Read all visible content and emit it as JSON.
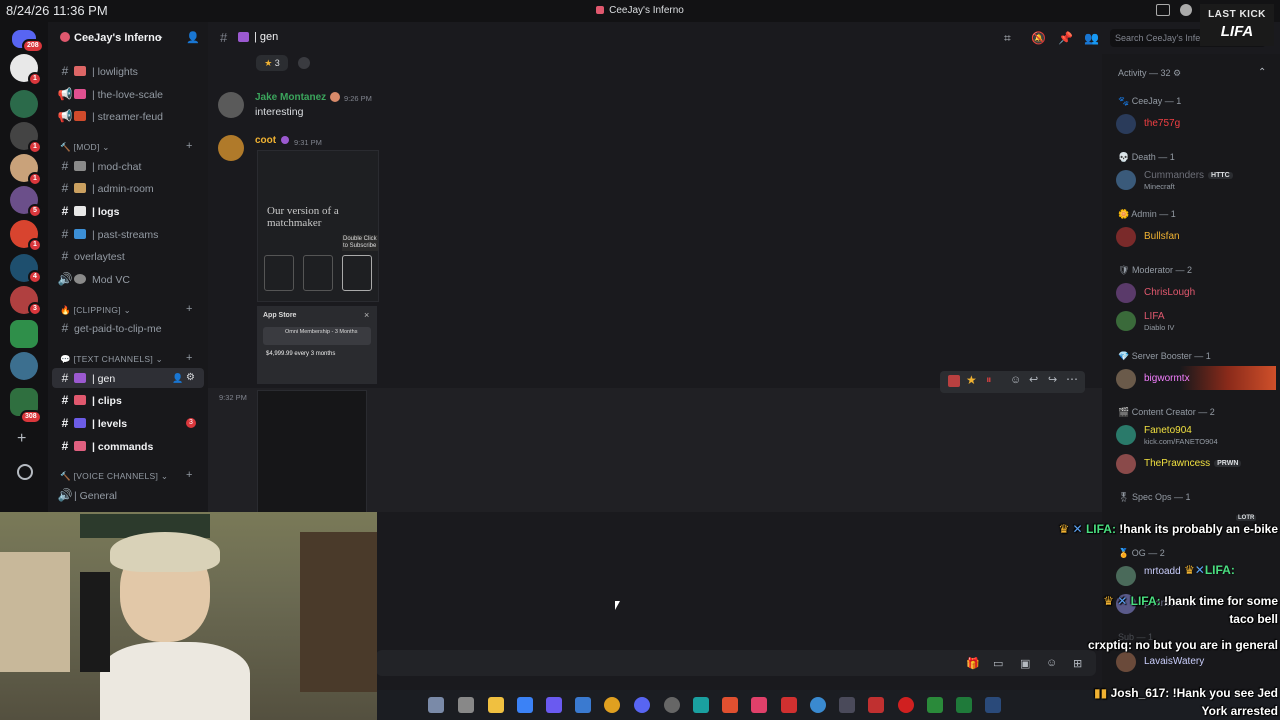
{
  "os": {
    "clock": "8/24/26 11:36 PM",
    "window_title": "CeeJay's Inferno"
  },
  "servers": {
    "badges": [
      "208",
      "1",
      "1",
      "1",
      "5",
      "1",
      "1",
      "4",
      "3",
      "3",
      "308"
    ]
  },
  "sidebar": {
    "server_name": "CeeJay's Inferno",
    "channels_top": [
      {
        "label": "| lowlights"
      },
      {
        "label": "| the-love-scale"
      },
      {
        "label": "| streamer-feud"
      }
    ],
    "cat_mod": "[MOD]",
    "mod_channels": [
      {
        "label": "| mod-chat"
      },
      {
        "label": "| admin-room"
      },
      {
        "label": "| logs"
      },
      {
        "label": "| past-streams"
      },
      {
        "label": "overlaytest"
      },
      {
        "label": "Mod VC"
      }
    ],
    "cat_clipping": "[CLIPPING]",
    "clip_channel": "get-paid-to-clip-me",
    "cat_text": "[TEXT CHANNELS]",
    "text_channels": [
      {
        "label": "gen"
      },
      {
        "label": "| clips"
      },
      {
        "label": "| levels",
        "badge": "3"
      },
      {
        "label": "| commands"
      }
    ],
    "cat_voice": "[VOICE CHANNELS]",
    "voice_channel": "| General"
  },
  "header": {
    "channel": "| gen",
    "search_placeholder": "Search CeeJay's Inferno"
  },
  "messages": {
    "reaction_count": "3",
    "m1": {
      "author": "Jake Montanez",
      "time": "9:26 PM",
      "text": "interesting"
    },
    "m2": {
      "author": "coot",
      "time": "9:31 PM"
    },
    "m3": {
      "time": "9:32 PM"
    },
    "shot1": {
      "title": "Our version of a matchmaker",
      "tooltip": "Double Click to Subscribe",
      "appstore": "App Store",
      "sub_title": "Omni Membership - 3 Months",
      "price": "$4,999.99 every 3 months"
    }
  },
  "members": {
    "activity": "Activity — 32",
    "groups": [
      {
        "title": "CeeJay — 1",
        "members": [
          {
            "name": "the757g"
          }
        ]
      },
      {
        "title": "Death — 1",
        "members": [
          {
            "name": "Cummanders",
            "tag": "HTTC",
            "sub": "Minecraft"
          }
        ]
      },
      {
        "title": "Admin — 1",
        "members": [
          {
            "name": "Bullsfan"
          }
        ]
      },
      {
        "title": "Moderator — 2",
        "members": [
          {
            "name": "ChrisLough"
          },
          {
            "name": "LIFA",
            "sub": "Diablo IV"
          }
        ]
      },
      {
        "title": "Server Booster — 1",
        "members": [
          {
            "name": "bigwormtx"
          }
        ]
      },
      {
        "title": "Content Creator — 2",
        "members": [
          {
            "name": "Faneto904",
            "sub": "kick.com/FANETO904"
          },
          {
            "name": "ThePrawncess",
            "tag": "PRWN"
          }
        ]
      },
      {
        "title": "Spec Ops — 1",
        "members": []
      },
      {
        "title": "OG — 2",
        "members": [
          {
            "name": "mrtoadd"
          },
          {
            "name": "phantomed"
          }
        ]
      },
      {
        "title": "Sub — 1",
        "members": [
          {
            "name": "LavaisWatery"
          }
        ]
      }
    ]
  },
  "overlay": {
    "kick_label": "LAST KICK",
    "kick_name": "LIFA",
    "chat": [
      {
        "user": "LIFA",
        "text": "!hank its probably an e-bike"
      },
      {
        "user": "LIFA",
        "text": "!hank time for some taco bell"
      },
      {
        "user": "crxptiq",
        "text": "no but you are in general"
      },
      {
        "user": "Josh_617",
        "text": "!Hank you see Jed York arrested"
      }
    ],
    "tag_lotr": "LOTR",
    "lifa_inline": "LIFA:"
  },
  "colors": {
    "accent": "#5865f2",
    "green_name": "#3ba55c",
    "red_name": "#f23f43",
    "gold_name": "#f0b232"
  }
}
